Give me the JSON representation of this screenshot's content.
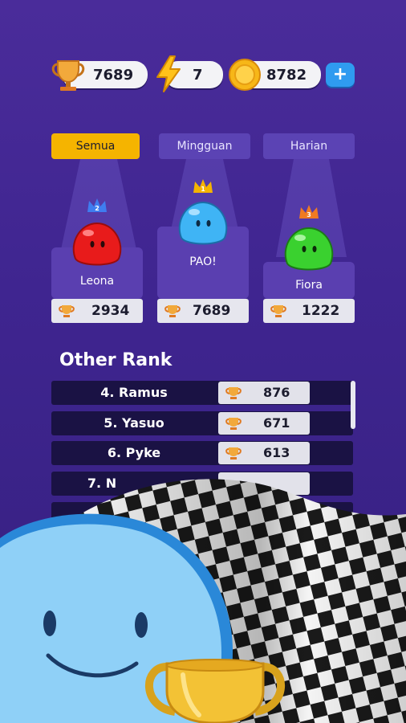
{
  "status": {
    "trophies": "7689",
    "energy": "7",
    "coins": "8782",
    "add_label": "+"
  },
  "tabs": [
    {
      "label": "Semua",
      "active": true
    },
    {
      "label": "Mingguan",
      "active": false
    },
    {
      "label": "Harian",
      "active": false
    }
  ],
  "podium": [
    {
      "rank": "2",
      "name": "Leona",
      "score": "2934",
      "color": "#e81b1b"
    },
    {
      "rank": "1",
      "name": "PAO!",
      "score": "7689",
      "color": "#3fb4f5"
    },
    {
      "rank": "3",
      "name": "Fiora",
      "score": "1222",
      "color": "#3ad12f"
    }
  ],
  "other_rank": {
    "title": "Other Rank",
    "rows": [
      {
        "name": "4. Ramus",
        "score": "876"
      },
      {
        "name": "5. Yasuo",
        "score": "671"
      },
      {
        "name": "6. Pyke",
        "score": "613"
      },
      {
        "name": "7. N",
        "score": ""
      }
    ]
  },
  "colors": {
    "accent": "#f5b400",
    "background": "#4a2c9a",
    "row": "#1a1244"
  }
}
